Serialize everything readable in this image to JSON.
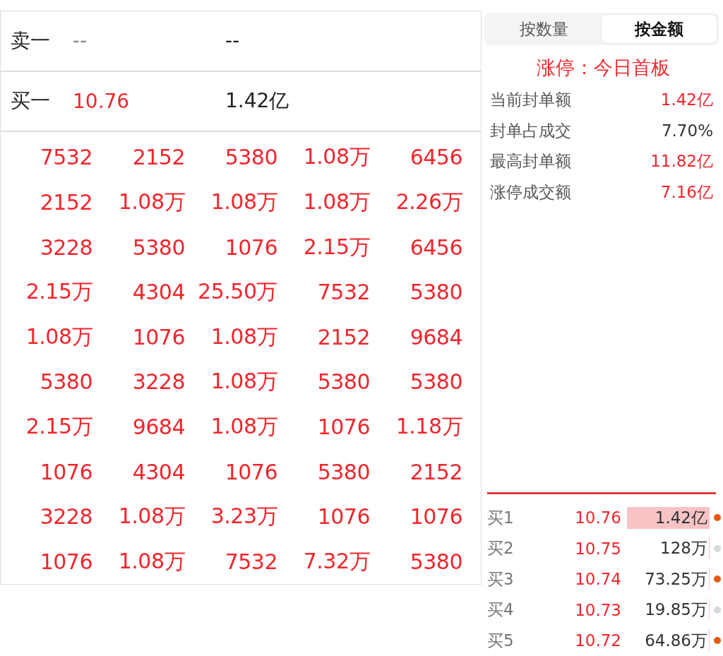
{
  "quote_rows": [
    {
      "label": "卖一",
      "price": "--",
      "amount": "--",
      "kind": "sell"
    },
    {
      "label": "买一",
      "price": "10.76",
      "amount": "1.42亿",
      "kind": "buy"
    }
  ],
  "orders": [
    [
      "7532",
      "2152",
      "5380",
      "1.08万",
      "6456"
    ],
    [
      "2152",
      "1.08万",
      "1.08万",
      "1.08万",
      "2.26万"
    ],
    [
      "3228",
      "5380",
      "1076",
      "2.15万",
      "6456"
    ],
    [
      "2.15万",
      "4304",
      "25.50万",
      "7532",
      "5380"
    ],
    [
      "1.08万",
      "1076",
      "1.08万",
      "2152",
      "9684"
    ],
    [
      "5380",
      "3228",
      "1.08万",
      "5380",
      "5380"
    ],
    [
      "2.15万",
      "9684",
      "1.08万",
      "1076",
      "1.18万"
    ],
    [
      "1076",
      "4304",
      "1076",
      "5380",
      "2152"
    ],
    [
      "3228",
      "1.08万",
      "3.23万",
      "1076",
      "1076"
    ],
    [
      "1076",
      "1.08万",
      "7532",
      "7.32万",
      "5380"
    ]
  ],
  "tabs": [
    {
      "label": "按数量",
      "selected": false
    },
    {
      "label": "按金额",
      "selected": true
    }
  ],
  "limit_status": "涨停：今日首板",
  "stats": [
    {
      "label": "当前封单额",
      "value": "1.42亿",
      "highlight": true
    },
    {
      "label": "封单占成交",
      "value": "7.70%",
      "highlight": false
    },
    {
      "label": "最高封单额",
      "value": "11.82亿",
      "highlight": true
    },
    {
      "label": "涨停成交额",
      "value": "7.16亿",
      "highlight": true
    }
  ],
  "bids": [
    {
      "label": "买1",
      "price": "10.76",
      "amount": "1.42亿",
      "selected": true,
      "color": "#e8590c"
    },
    {
      "label": "买2",
      "price": "10.75",
      "amount": "128万",
      "selected": false,
      "color": "#d5d8de"
    },
    {
      "label": "买3",
      "price": "10.74",
      "amount": "73.25万",
      "selected": false,
      "color": "#e8590c"
    },
    {
      "label": "买4",
      "price": "10.73",
      "amount": "19.85万",
      "selected": false,
      "color": "#d5d8de"
    },
    {
      "label": "买5",
      "price": "10.72",
      "amount": "64.86万",
      "selected": false,
      "color": "#e8590c"
    }
  ]
}
